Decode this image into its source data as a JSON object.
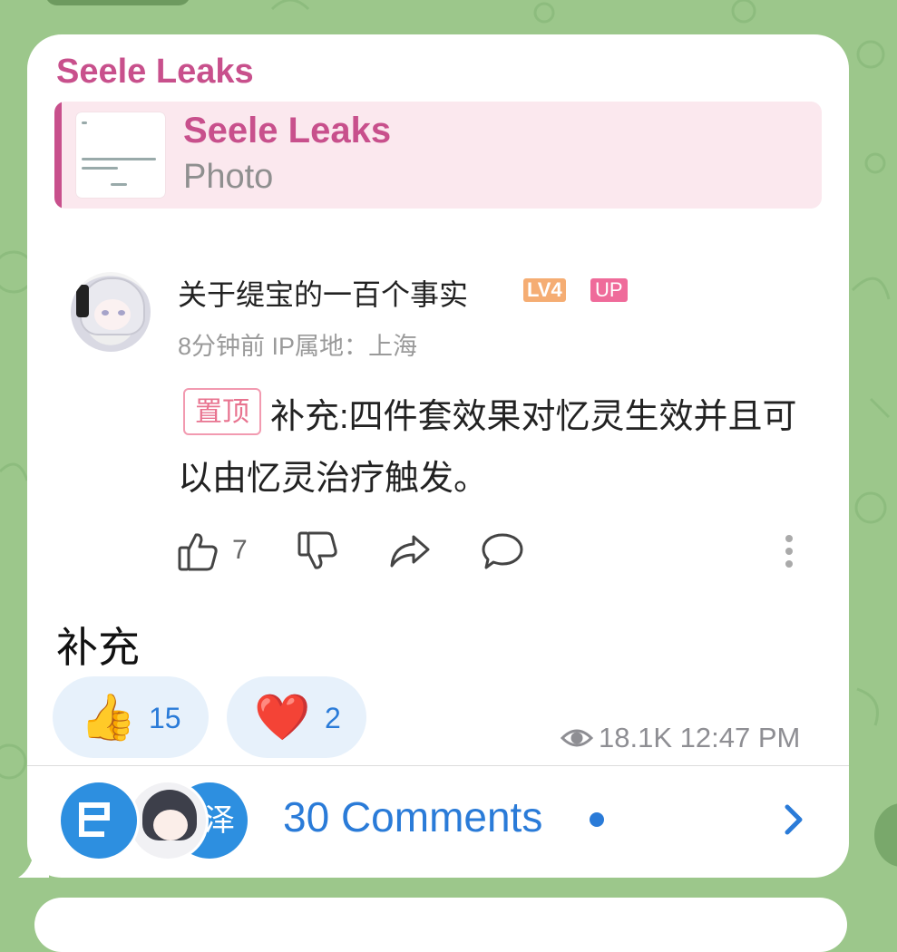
{
  "message": {
    "sender": "Seele Leaks",
    "reply": {
      "name": "Seele Leaks",
      "subtitle": "Photo"
    },
    "embedded_comment": {
      "username": "关于缇宝的一百个事实",
      "level_badge": "LV4",
      "up_badge": "UP",
      "meta": "8分钟前 IP属地：上海",
      "pinned_tag": "置顶",
      "text": "补充:四件套效果对忆灵生效并且可以由忆灵治疗触发。",
      "like_count": "7"
    },
    "body": "补充",
    "reactions": [
      {
        "emoji": "👍",
        "count": "15"
      },
      {
        "emoji": "❤️",
        "count": "2"
      }
    ],
    "views": "18.1K",
    "time": "12:47 PM",
    "comments": {
      "avatar3_text": "泽",
      "label": "30 Comments"
    }
  },
  "colors": {
    "sender": "#c8508c",
    "link_blue": "#2a7bd8",
    "background": "#9cc78b"
  },
  "icons": [
    "thumbs-up-icon",
    "thumbs-down-icon",
    "share-icon",
    "reply-bubble-icon",
    "more-vertical-icon",
    "eye-icon",
    "chevron-right-icon"
  ]
}
